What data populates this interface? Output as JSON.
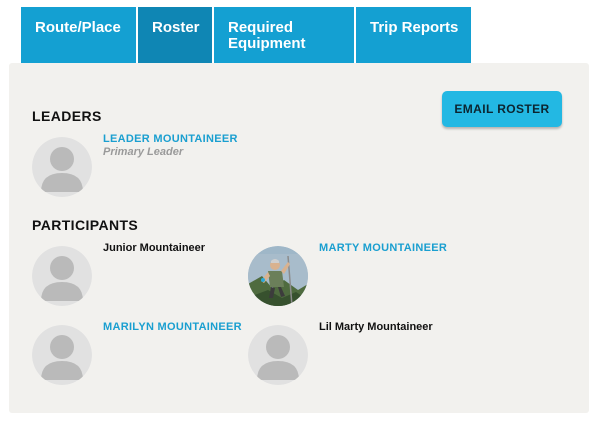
{
  "tabs": [
    {
      "label": "Route/Place"
    },
    {
      "label": "Roster"
    },
    {
      "label": "Required Equipment"
    },
    {
      "label": "Trip Reports"
    }
  ],
  "active_tab": "Roster",
  "roster": {
    "email_button_label": "EMAIL ROSTER",
    "leaders_heading": "LEADERS",
    "participants_heading": "PARTICIPANTS",
    "leaders": [
      {
        "name": "LEADER MOUNTAINEER",
        "role": "Primary Leader",
        "avatar": "default-avatar",
        "linked": true
      }
    ],
    "participants": [
      {
        "name": "Junior Mountaineer",
        "avatar": "default-avatar",
        "linked": false
      },
      {
        "name": "MARTY MOUNTAINEER",
        "avatar": "climber-photo",
        "linked": true
      },
      {
        "name": "MARILYN MOUNTAINEER",
        "avatar": "default-avatar",
        "linked": true
      },
      {
        "name": "Lil Marty Mountaineer",
        "avatar": "default-avatar",
        "linked": false
      }
    ]
  },
  "colors": {
    "tab": "#14a0d2",
    "tab_active": "#0f86b4",
    "panel": "#f2f1ee",
    "link": "#1a9fd0",
    "button": "#23b8e3"
  }
}
